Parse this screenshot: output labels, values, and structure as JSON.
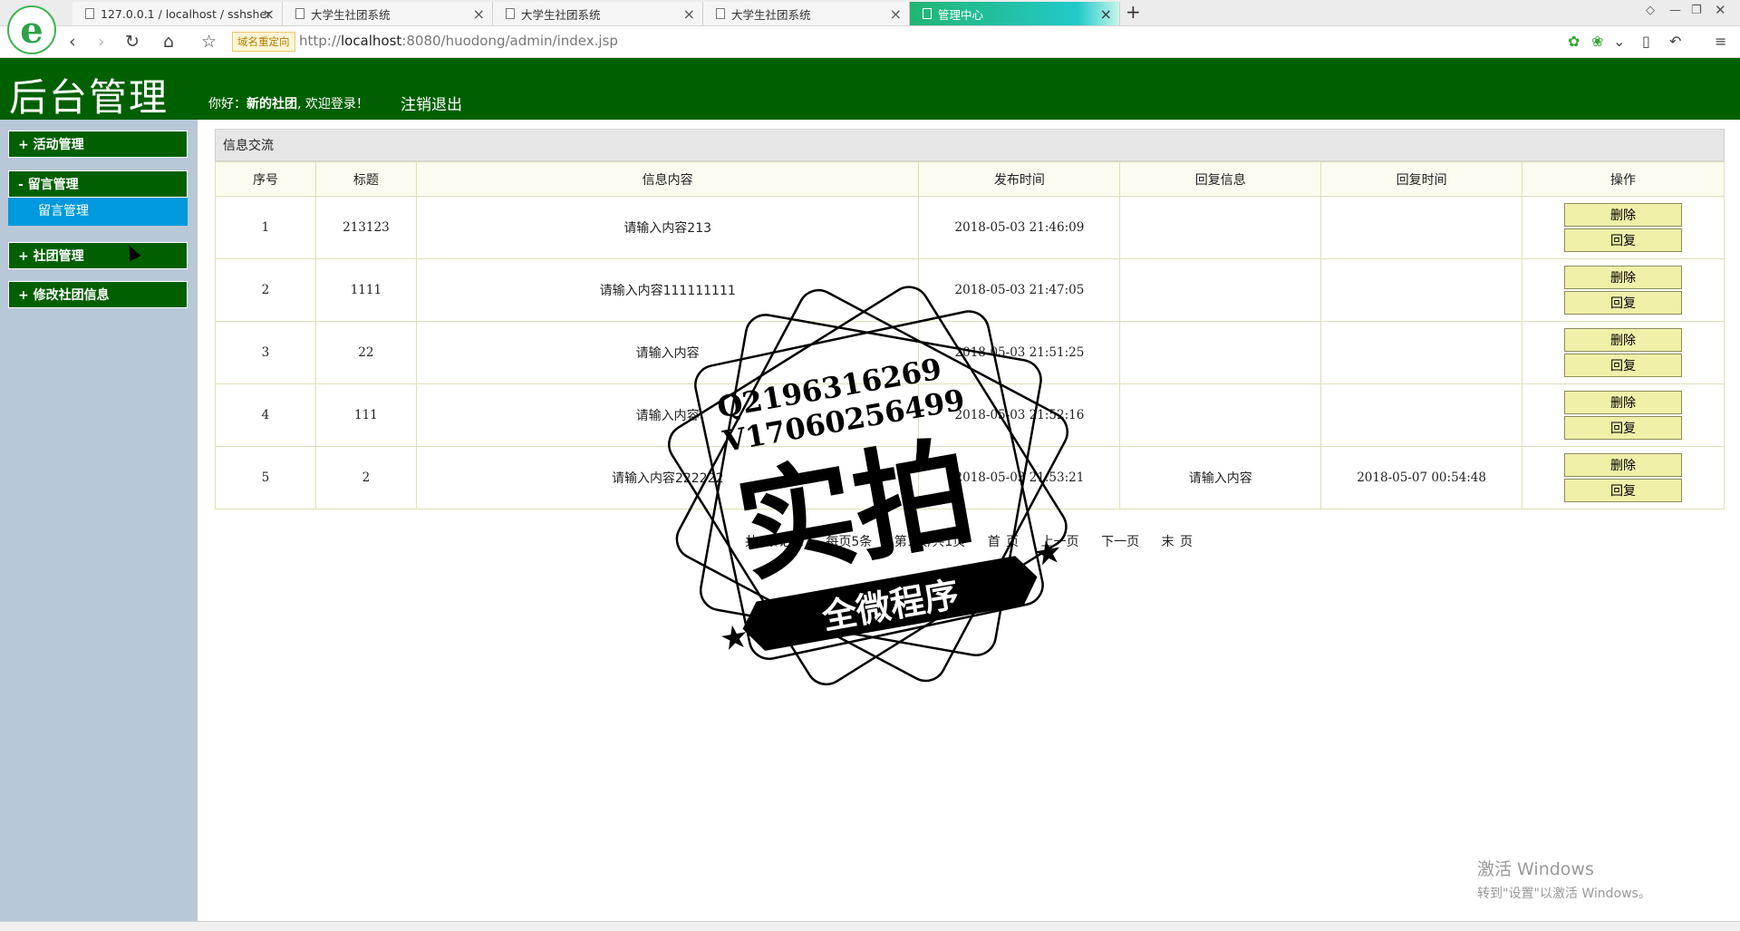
{
  "browser": {
    "tabs": [
      {
        "label": "127.0.0.1 / localhost / sshsher",
        "active": false
      },
      {
        "label": "大学生社团系统",
        "active": false
      },
      {
        "label": "大学生社团系统",
        "active": false
      },
      {
        "label": "大学生社团系统",
        "active": false
      },
      {
        "label": "管理中心",
        "active": true
      }
    ],
    "new_tab": "+",
    "redirect_badge": "域名重定向",
    "url_host": "localhost",
    "url_prefix": "http://",
    "url_rest": ":8080/huodong/admin/index.jsp"
  },
  "header": {
    "brand": "后台管理",
    "greet_prefix": "你好：",
    "user": "新的社团",
    "greet_suffix": ", 欢迎登录！",
    "logout": "注销退出"
  },
  "sidebar": {
    "items": [
      {
        "label": "+ 活动管理"
      },
      {
        "label": "- 留言管理"
      },
      {
        "label": "+ 社团管理"
      },
      {
        "label": "+ 修改社团信息"
      }
    ],
    "subitem": "留言管理"
  },
  "main": {
    "title": "信息交流",
    "columns": [
      "序号",
      "标题",
      "信息内容",
      "发布时间",
      "回复信息",
      "回复时间",
      "操作"
    ],
    "rows": [
      {
        "no": "1",
        "title": "213123",
        "content": "请输入内容213",
        "time": "2018-05-03 21:46:09",
        "reply": "",
        "reply_time": ""
      },
      {
        "no": "2",
        "title": "1111",
        "content": "请输入内容111111111",
        "time": "2018-05-03 21:47:05",
        "reply": "",
        "reply_time": ""
      },
      {
        "no": "3",
        "title": "22",
        "content": "请输入内容",
        "time": "2018-05-03 21:51:25",
        "reply": "",
        "reply_time": ""
      },
      {
        "no": "4",
        "title": "111",
        "content": "请输入内容",
        "time": "2018-05-03 21:52:16",
        "reply": "",
        "reply_time": ""
      },
      {
        "no": "5",
        "title": "2",
        "content": "请输入内容222222",
        "time": "2018-05-03 21:53:21",
        "reply": "请输入内容",
        "reply_time": "2018-05-07 00:54:48"
      }
    ],
    "delete_label": "删除",
    "reply_label": "回复",
    "pager": {
      "total": "共5条记录",
      "per_page": "每页5条",
      "page": "第1页/共1页",
      "first": "首 页",
      "prev": "上一页",
      "next": "下一页",
      "last": "末 页"
    }
  },
  "watermark": {
    "line1": "Q2196316269",
    "line2": "V17060256499",
    "big": "实拍",
    "banner": "全微程序"
  },
  "windows_activation": {
    "line1": "激活 Windows",
    "line2": "转到\"设置\"以激活 Windows。"
  },
  "colors": {
    "header": "#006000",
    "sidebar": "#b8c8d8",
    "submenu": "#0099dd",
    "button": "#f0f0a8"
  }
}
